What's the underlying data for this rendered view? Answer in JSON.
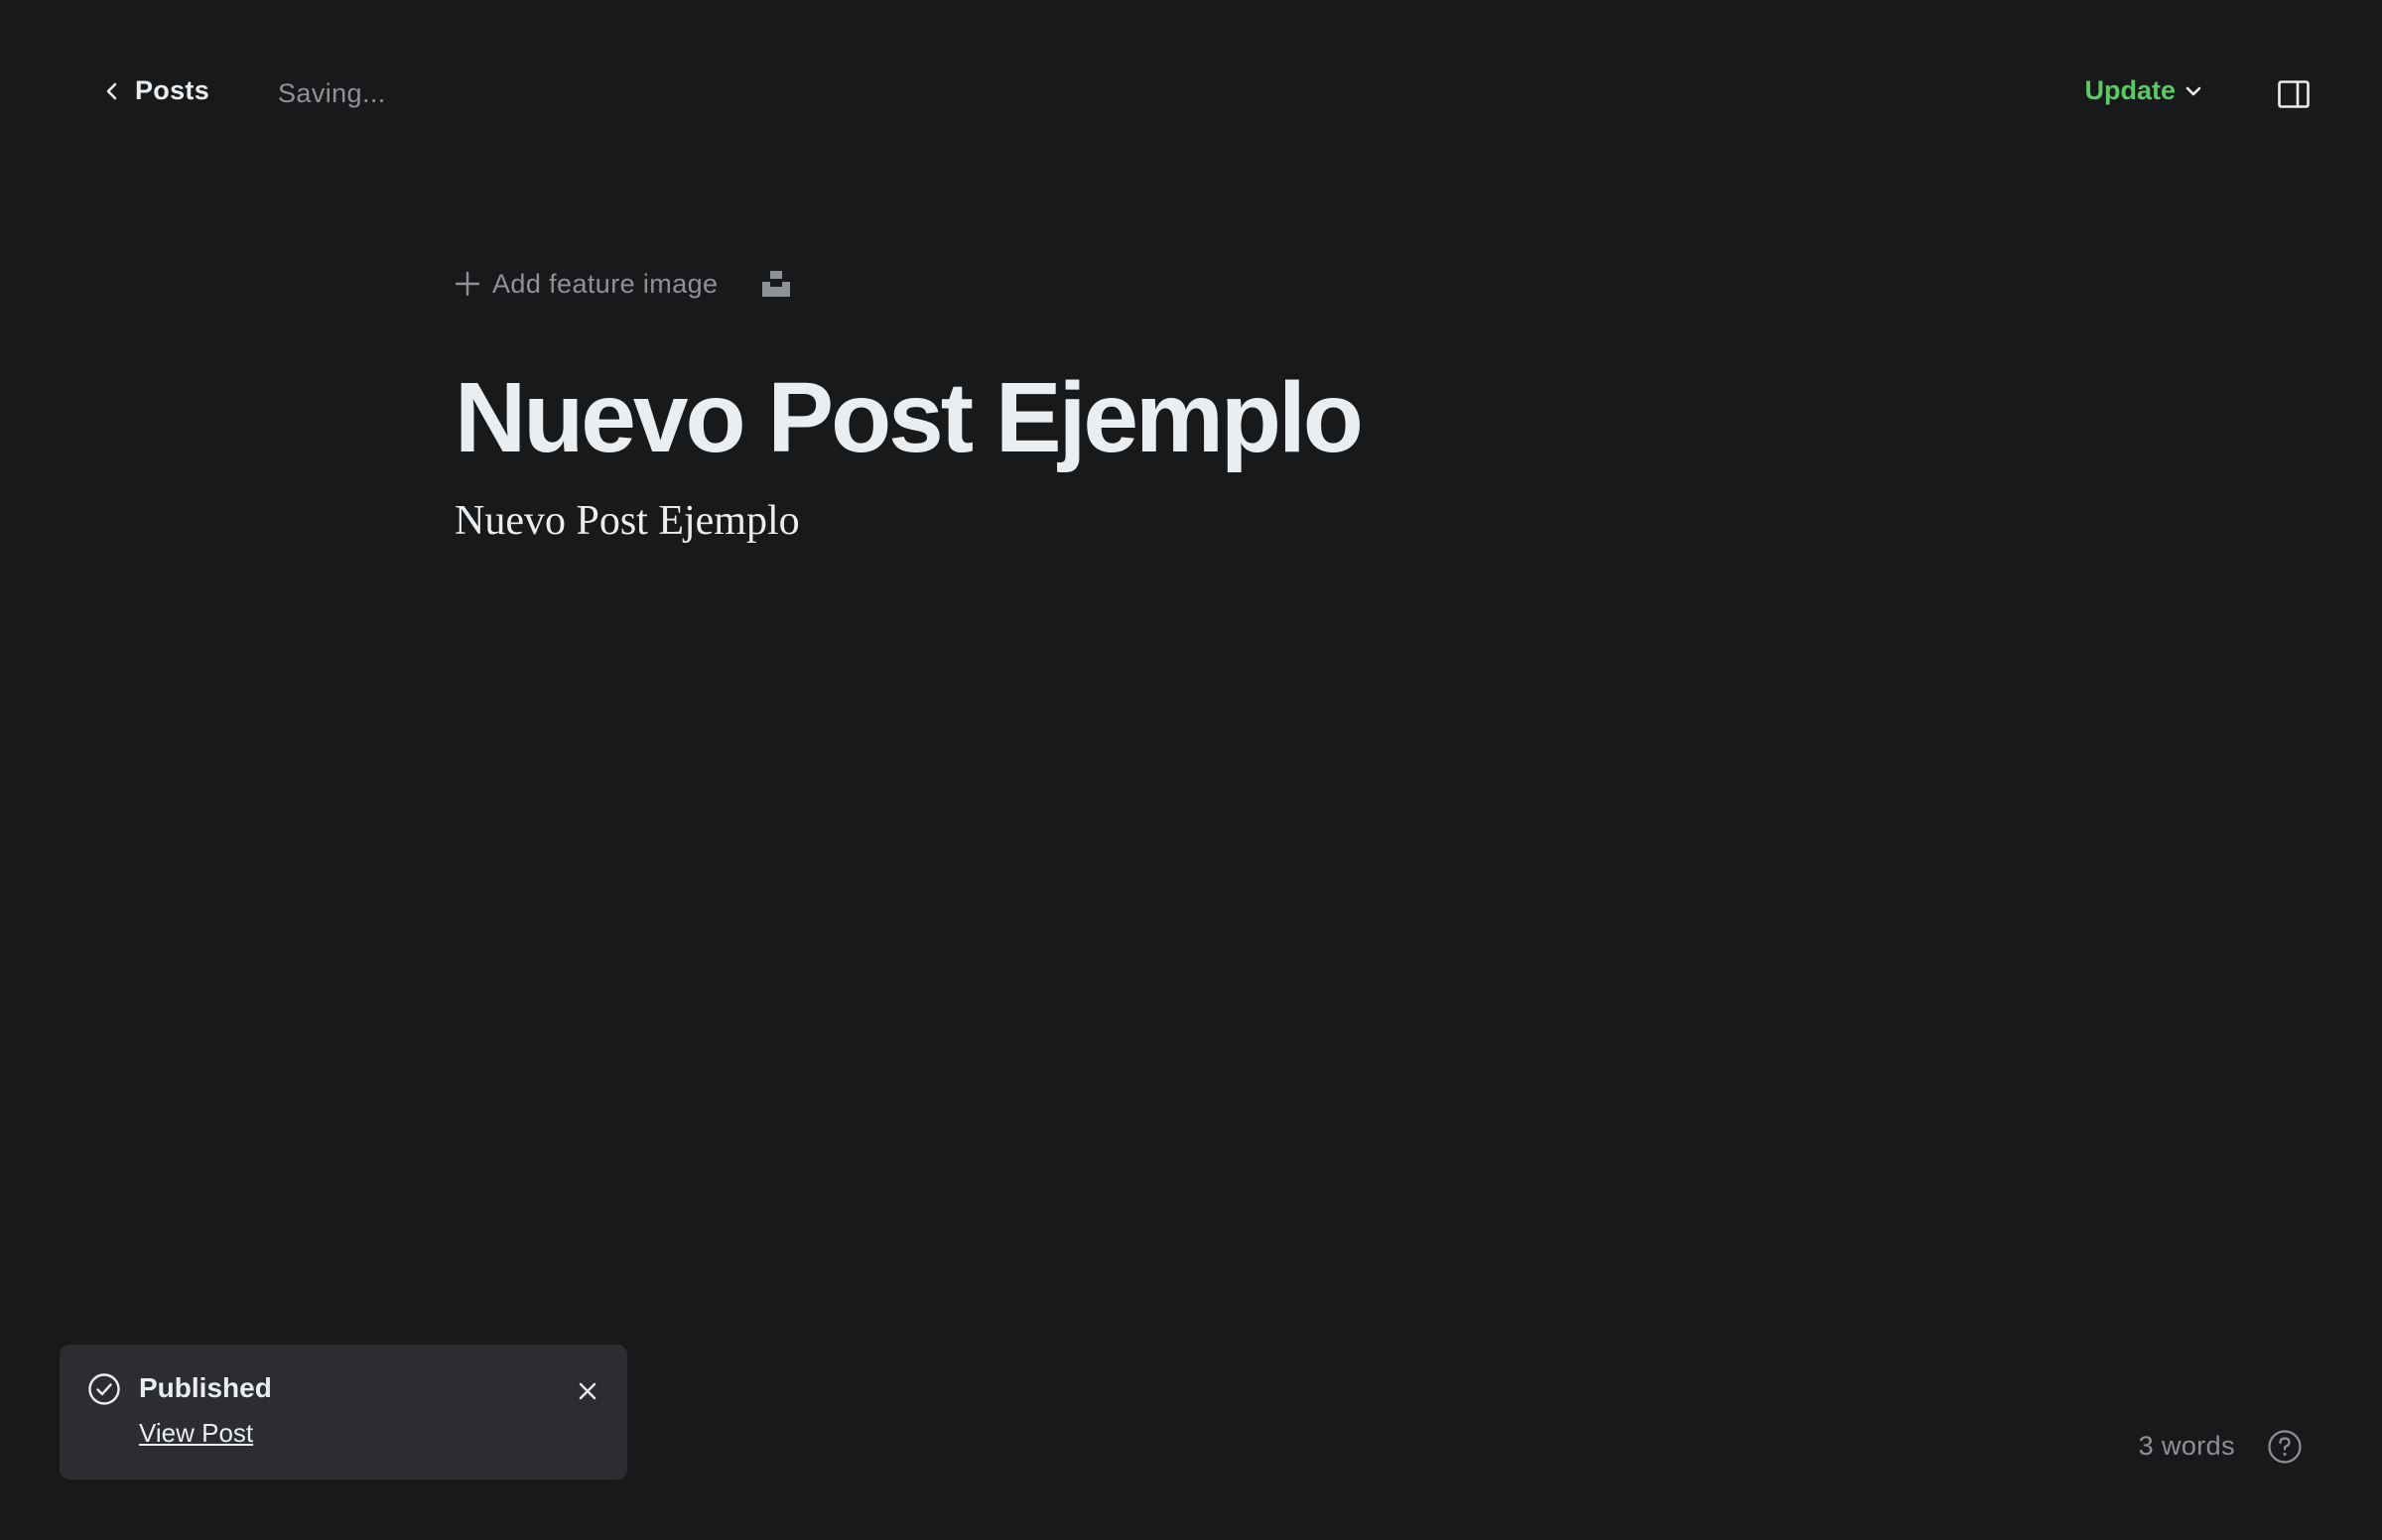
{
  "topbar": {
    "back_label": "Posts",
    "status": "Saving...",
    "update_label": "Update"
  },
  "editor": {
    "add_feature_image": "Add feature image",
    "title": "Nuevo Post Ejemplo",
    "body": "Nuevo Post Ejemplo"
  },
  "toast": {
    "title": "Published",
    "link": "View Post"
  },
  "footer": {
    "word_count": "3 words"
  },
  "colors": {
    "background": "#18191b",
    "accent": "#5cc964",
    "muted_text": "#8e9297",
    "toast_bg": "#2b2d31"
  },
  "icons": [
    "chevron-left-icon",
    "chevron-down-icon",
    "sidebar-toggle-icon",
    "plus-icon",
    "unsplash-icon",
    "check-circle-icon",
    "close-icon",
    "help-icon"
  ]
}
